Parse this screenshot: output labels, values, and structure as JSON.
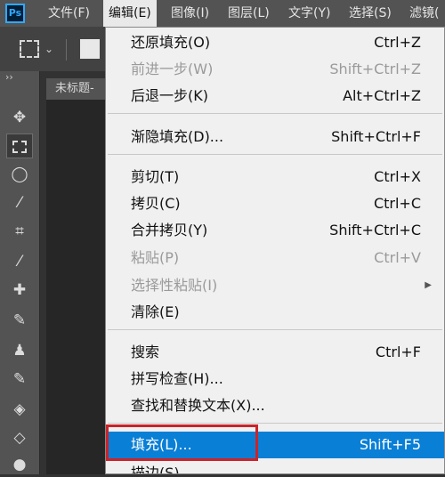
{
  "app": {
    "logo": "Ps"
  },
  "menubar": {
    "items": [
      {
        "label": "文件(F)"
      },
      {
        "label": "编辑(E)"
      },
      {
        "label": "图像(I)"
      },
      {
        "label": "图层(L)"
      },
      {
        "label": "文字(Y)"
      },
      {
        "label": "选择(S)"
      },
      {
        "label": "滤镜("
      }
    ]
  },
  "document": {
    "tab_title": "未标题-"
  },
  "toolbox": {
    "collapse": "››",
    "tools": [
      "move-icon",
      "marquee-icon",
      "lasso-icon",
      "magic-wand-icon",
      "crop-icon",
      "eyedropper-icon",
      "healing-icon",
      "brush-icon",
      "stamp-icon",
      "history-brush-icon",
      "eraser-icon",
      "paint-bucket-icon",
      "blur-icon"
    ]
  },
  "edit_menu": {
    "items": [
      {
        "label": "还原填充(O)",
        "shortcut": "Ctrl+Z"
      },
      {
        "label": "前进一步(W)",
        "shortcut": "Shift+Ctrl+Z"
      },
      {
        "label": "后退一步(K)",
        "shortcut": "Alt+Ctrl+Z"
      },
      {
        "label": "渐隐填充(D)...",
        "shortcut": "Shift+Ctrl+F"
      },
      {
        "label": "剪切(T)",
        "shortcut": "Ctrl+X"
      },
      {
        "label": "拷贝(C)",
        "shortcut": "Ctrl+C"
      },
      {
        "label": "合并拷贝(Y)",
        "shortcut": "Shift+Ctrl+C"
      },
      {
        "label": "粘贴(P)",
        "shortcut": "Ctrl+V"
      },
      {
        "label": "选择性粘贴(I)",
        "shortcut": ""
      },
      {
        "label": "清除(E)",
        "shortcut": ""
      },
      {
        "label": "搜索",
        "shortcut": "Ctrl+F"
      },
      {
        "label": "拼写检查(H)...",
        "shortcut": ""
      },
      {
        "label": "查找和替换文本(X)...",
        "shortcut": ""
      },
      {
        "label": "填充(L)...",
        "shortcut": "Shift+F5"
      },
      {
        "label": "描边(S)...",
        "shortcut": ""
      }
    ]
  },
  "colors": {
    "highlight": "#0a7fd6",
    "annotation": "#c9242a",
    "menubar": "#535353"
  }
}
